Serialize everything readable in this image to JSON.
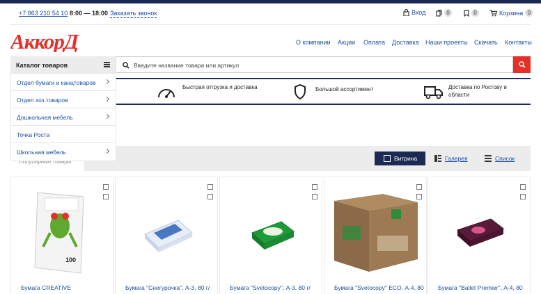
{
  "topbar": {
    "phone": "+7 863 210 54 10",
    "hours": "8:00 — 18:00",
    "callback": "Заказать звонок",
    "login": "Вход",
    "compare_count": "0",
    "favorites_count": "0",
    "cart_label": "Корзина",
    "cart_count": "0"
  },
  "brand": {
    "logo_text": "АккорД",
    "logo_color": "#e53027"
  },
  "nav": [
    "О компании",
    "Акции",
    "Оплата",
    "Доставка",
    "Наши проекты",
    "Скачать",
    "Контакты"
  ],
  "catalog": {
    "title": "Каталог товаров",
    "items": [
      {
        "label": "Отдел бумаги и канцтоваров",
        "has_children": true
      },
      {
        "label": "Отдел хоз.товаров",
        "has_children": true
      },
      {
        "label": "Дошкольная мебель",
        "has_children": true
      },
      {
        "label": "Точка Роста",
        "has_children": false
      },
      {
        "label": "Школьная мебель",
        "has_children": true
      }
    ]
  },
  "search": {
    "placeholder": "Введите название товара или артикул"
  },
  "features": [
    {
      "text": "Быстрая отгрузка и доставка",
      "icon": "speedometer-icon"
    },
    {
      "text": "Большой ассортимент",
      "icon": "shield-icon"
    },
    {
      "text": "Доставка по Ростову и области",
      "icon": "truck-icon"
    }
  ],
  "tabs": {
    "popular": "Популярные товары"
  },
  "views": {
    "showcase": "Витрина",
    "gallery": "Галерея",
    "list": "Список"
  },
  "products": [
    {
      "title": "Бумага CREATIVE"
    },
    {
      "title": "Бумага \"Снегурочка\", А-3, 80 г/"
    },
    {
      "title": "Бумага \"Svetocopy\", А-3, 80 г/"
    },
    {
      "title": "Бумага \"Svetocopy\" ECO, А-4, 80"
    },
    {
      "title": "Бумага \"Ballet Premier\", А-4, 80"
    }
  ],
  "colors": {
    "accent": "#e53027",
    "navy": "#1a2a52",
    "link": "#1a4fa0"
  }
}
